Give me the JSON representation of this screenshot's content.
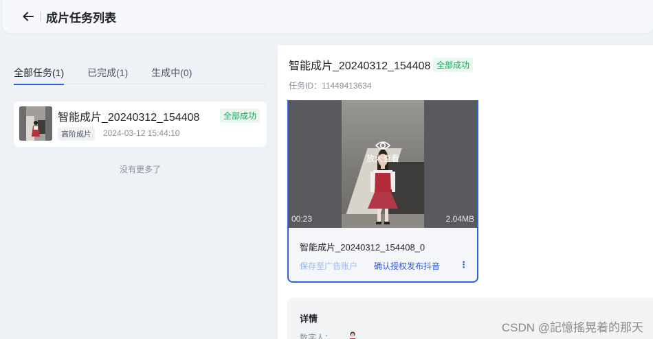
{
  "header": {
    "title": "成片任务列表",
    "back_icon": "arrow-left-icon"
  },
  "tabs": [
    {
      "label": "全部任务(1)",
      "active": true
    },
    {
      "label": "已完成(1)",
      "active": false
    },
    {
      "label": "生成中(0)",
      "active": false
    }
  ],
  "task_list": {
    "items": [
      {
        "name": "智能成片_20240312_154408",
        "status": "全部成功",
        "tag": "高阶成片",
        "time": "2024-03-12 15:44:10"
      }
    ],
    "end_text": "没有更多了"
  },
  "detail": {
    "title": "智能成片_20240312_154408",
    "status": "全部成功",
    "task_id": "任务ID：11449413634",
    "video": {
      "zoom_label": "放大查看",
      "duration": "00:23",
      "size": "2.04MB",
      "name": "智能成片_20240312_154408_0",
      "save_label": "保存至广告账户",
      "publish_label": "确认授权发布抖音",
      "more_label": "⋮"
    },
    "info": {
      "title": "详情",
      "digital_human_label": "数字人："
    }
  },
  "watermark": "CSDN @記憶搖晃着的那天",
  "colors": {
    "accent": "#2e5bd8",
    "success": "#14a35a",
    "success_bg": "#e9f7ef"
  }
}
